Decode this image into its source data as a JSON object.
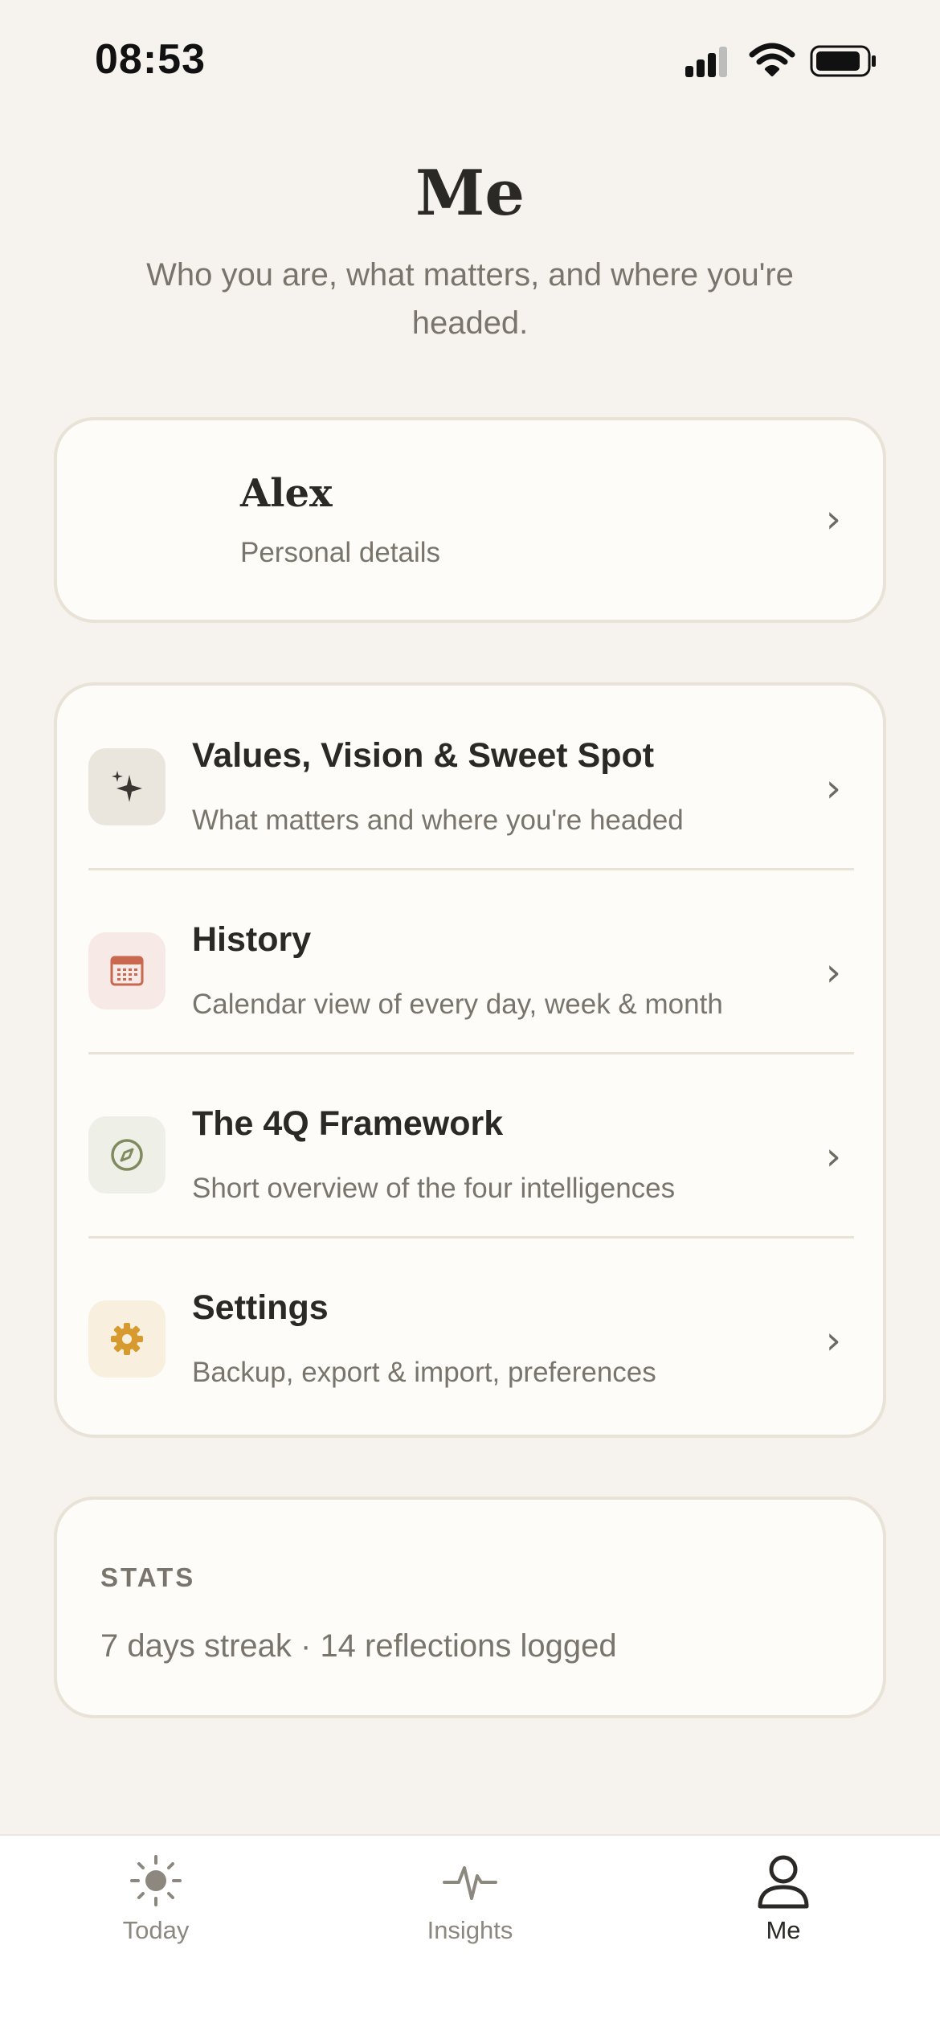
{
  "status_bar": {
    "time": "08:53"
  },
  "header": {
    "title": "Me",
    "subtitle": "Who you are, what matters, and where you're headed."
  },
  "profile": {
    "name": "Alex",
    "subtitle": "Personal details"
  },
  "menu": {
    "items": [
      {
        "title": "Values, Vision & Sweet Spot",
        "subtitle": "What matters and where you're headed",
        "icon": "sparkle-icon",
        "icon_bg": "#EAE6DD"
      },
      {
        "title": "History",
        "subtitle": "Calendar view of every day, week & month",
        "icon": "calendar-icon",
        "icon_bg": "#F6E9E6"
      },
      {
        "title": "The 4Q Framework",
        "subtitle": "Short overview of the four intelligences",
        "icon": "compass-icon",
        "icon_bg": "#EEF0E8"
      },
      {
        "title": "Settings",
        "subtitle": "Backup, export & import, preferences",
        "icon": "gear-icon",
        "icon_bg": "#F8EFDF"
      }
    ]
  },
  "stats": {
    "label": "STATS",
    "text": "7 days streak · 14 reflections logged"
  },
  "tab_bar": {
    "tabs": [
      {
        "label": "Today",
        "icon": "sun-icon",
        "active": false
      },
      {
        "label": "Insights",
        "icon": "pulse-icon",
        "active": false
      },
      {
        "label": "Me",
        "icon": "person-icon",
        "active": true
      }
    ]
  },
  "colors": {
    "background": "#F6F3EE",
    "card": "#FDFCF9",
    "calendar_accent": "#C9684F",
    "compass_accent": "#7F8A5E",
    "gear_accent": "#D69A2E"
  }
}
